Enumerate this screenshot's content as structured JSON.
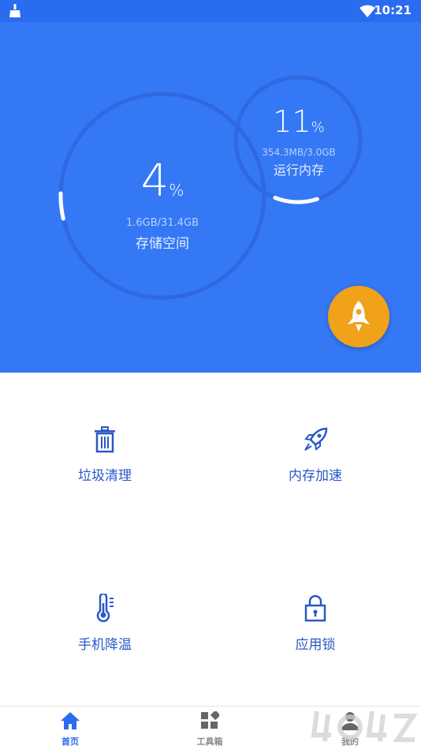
{
  "status_bar": {
    "time": "10:21",
    "icons": [
      "broom-icon",
      "wifi-icon"
    ]
  },
  "storage": {
    "percent": "4",
    "unit": "%",
    "detail": "1.6GB/31.4GB",
    "label": "存储空间",
    "fraction": 0.04
  },
  "ram": {
    "percent": "11",
    "unit": "%",
    "detail": "354.3MB/3.0GB",
    "label": "运行内存",
    "fraction": 0.11
  },
  "boost_icon": "rocket-icon",
  "features": [
    {
      "label": "垃圾清理",
      "icon": "trash-icon"
    },
    {
      "label": "内存加速",
      "icon": "rocket-icon"
    },
    {
      "label": "手机降温",
      "icon": "thermometer-icon"
    },
    {
      "label": "应用锁",
      "icon": "lock-icon"
    }
  ],
  "nav": [
    {
      "label": "首页",
      "icon": "home-icon",
      "active": true
    },
    {
      "label": "工具箱",
      "icon": "toolbox-icon",
      "active": false
    },
    {
      "label": "我的",
      "icon": "profile-icon",
      "active": false
    }
  ],
  "colors": {
    "primary": "#3478f6",
    "status_bar": "#2a6cf0",
    "accent": "#f0a21a",
    "feature_text": "#2b58c8"
  }
}
